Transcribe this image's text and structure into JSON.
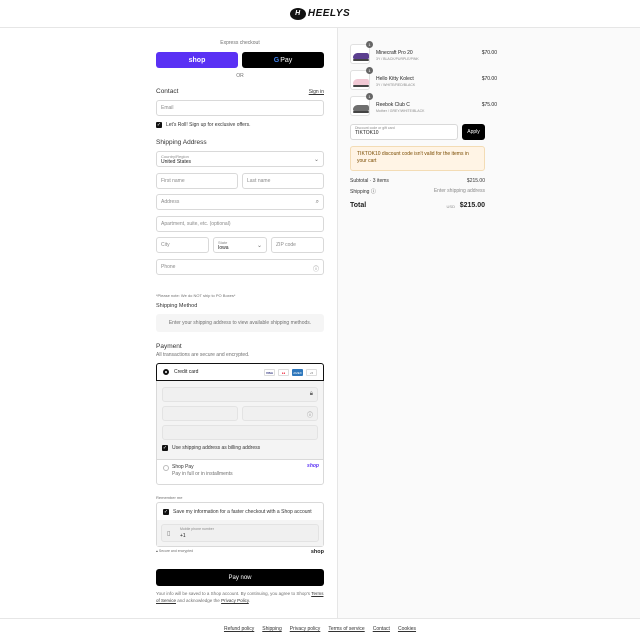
{
  "brand": {
    "name": "HEELYS",
    "mark": "H"
  },
  "express": {
    "label": "Express checkout",
    "shop_label": "shop",
    "gpay_g": "G",
    "gpay_label": "Pay",
    "or_label": "OR"
  },
  "contact": {
    "title": "Contact",
    "sign_in": "Sign in",
    "email_placeholder": "Email",
    "newsletter_label": "Let's Roll! Sign up for exclusive offers."
  },
  "shipping_address": {
    "title": "Shipping Address",
    "country_label": "Country/Region",
    "country_value": "United States",
    "first_name": "First name",
    "last_name": "Last name",
    "address": "Address",
    "apartment": "Apartment, suite, etc. (optional)",
    "city": "City",
    "state_label": "State",
    "state_value": "Iowa",
    "zip": "ZIP code",
    "phone": "Phone",
    "po_note": "*Please note: We do NOT ship to PO Boxes*"
  },
  "shipping_method": {
    "title": "Shipping Method",
    "placeholder": "Enter your shipping address to view available shipping methods."
  },
  "payment": {
    "title": "Payment",
    "subtitle": "All transactions are secure and encrypted.",
    "credit_card_label": "Credit card",
    "cards": [
      "VISA",
      "MC",
      "AMEX",
      "+5"
    ],
    "billing_same_label": "Use shipping address as billing address",
    "shop_pay_label": "Shop Pay",
    "shop_pay_sub": "Pay in full or in installments",
    "shop_pay_brand": "shop"
  },
  "remember": {
    "label": "Remember me",
    "save_label": "Save my information for a faster checkout with a Shop account",
    "phone_label": "Mobile phone number",
    "phone_value": "+1",
    "secure_label": "Secure and encrypted",
    "shop_mark": "shop"
  },
  "pay_now": "Pay now",
  "terms": {
    "before": "Your info will be saved to a Shop account. By continuing, you agree to Shop's",
    "tos": "Terms of Service",
    "mid": "and acknowledge the",
    "privacy": "Privacy Policy",
    "end": "."
  },
  "footer": [
    "Refund policy",
    "Shipping",
    "Privacy policy",
    "Terms of service",
    "Contact",
    "Cookies"
  ],
  "cart": {
    "items": [
      {
        "qty": "1",
        "name": "Minecraft Pro 20",
        "variant": "3Y / BLACK/PURPLE/PINK",
        "price": "$70.00",
        "color": "#5b3f8f"
      },
      {
        "qty": "1",
        "name": "Hello Kitty Kolect",
        "variant": "3Y / WHITE/RED/BLACK",
        "price": "$70.00",
        "color": "#f1c8d4"
      },
      {
        "qty": "1",
        "name": "Reebok Club C",
        "variant": "Mother / GREY/WHITE/BLACK",
        "price": "$75.00",
        "color": "#6f6f6f"
      }
    ],
    "discount_label": "Discount code or gift card",
    "discount_value": "TIKTOK10",
    "apply_label": "Apply",
    "warning": "TIKTOK10 discount code isn't valid for the items in your cart",
    "subtotal_label": "Subtotal · 3 items",
    "subtotal_value": "$215.00",
    "shipping_label": "Shipping",
    "shipping_value": "Enter shipping address",
    "total_label": "Total",
    "currency": "USD",
    "total_value": "$215.00"
  }
}
